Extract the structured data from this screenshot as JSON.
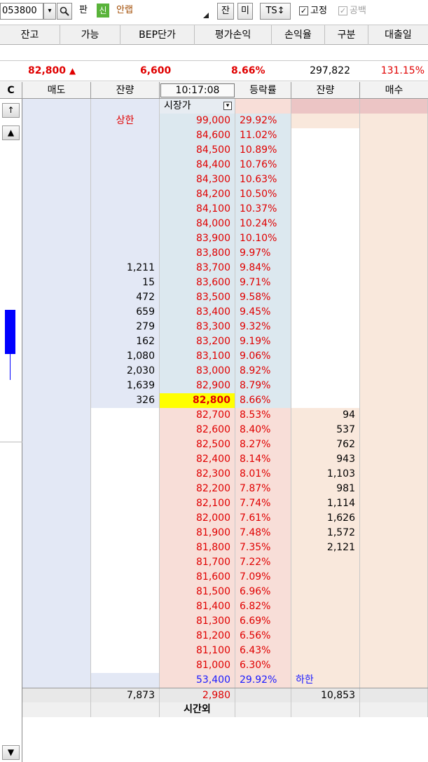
{
  "toolbar": {
    "code": "053800",
    "pan_label": "판",
    "sin_label": "신",
    "stock_name": "안랩",
    "jan_label": "잔",
    "mi_label": "미",
    "ts_label": "TS↕",
    "fix_label": "고정",
    "blank_label": "공백",
    "fix_checked": "✓",
    "blank_checked": "✓"
  },
  "columns": [
    "잔고",
    "가능",
    "BEP단가",
    "평가손익",
    "손익율",
    "구분",
    "대출일"
  ],
  "summary": {
    "price": "82,800",
    "arrow": "▲",
    "change": "6,600",
    "rate": "8.66%",
    "volume": "297,822",
    "ratio": "131.15%"
  },
  "orderbook": {
    "c_label": "C",
    "sell_label": "매도",
    "sell_qty_label": "잔량",
    "time": "10:17:08",
    "rate_label": "등락률",
    "buy_qty_label": "잔량",
    "buy_label": "매수",
    "market_price_label": "시장가",
    "dropdown_icon": "▾",
    "upper_limit_label": "상한",
    "lower_limit_label": "하한",
    "upper_limit_price": "99,000",
    "upper_limit_rate": "29.92%",
    "lower_limit_price": "53,400",
    "lower_limit_rate": "29.92%",
    "ask_rows": [
      {
        "qty": "",
        "price": "84,600",
        "rate": "11.02%"
      },
      {
        "qty": "",
        "price": "84,500",
        "rate": "10.89%"
      },
      {
        "qty": "",
        "price": "84,400",
        "rate": "10.76%"
      },
      {
        "qty": "",
        "price": "84,300",
        "rate": "10.63%"
      },
      {
        "qty": "",
        "price": "84,200",
        "rate": "10.50%"
      },
      {
        "qty": "",
        "price": "84,100",
        "rate": "10.37%"
      },
      {
        "qty": "",
        "price": "84,000",
        "rate": "10.24%"
      },
      {
        "qty": "",
        "price": "83,900",
        "rate": "10.10%"
      },
      {
        "qty": "",
        "price": "83,800",
        "rate": "9.97%"
      },
      {
        "qty": "1,211",
        "price": "83,700",
        "rate": "9.84%"
      },
      {
        "qty": "15",
        "price": "83,600",
        "rate": "9.71%"
      },
      {
        "qty": "472",
        "price": "83,500",
        "rate": "9.58%"
      },
      {
        "qty": "659",
        "price": "83,400",
        "rate": "9.45%"
      },
      {
        "qty": "279",
        "price": "83,300",
        "rate": "9.32%"
      },
      {
        "qty": "162",
        "price": "83,200",
        "rate": "9.19%"
      },
      {
        "qty": "1,080",
        "price": "83,100",
        "rate": "9.06%"
      },
      {
        "qty": "2,030",
        "price": "83,000",
        "rate": "8.92%"
      },
      {
        "qty": "1,639",
        "price": "82,900",
        "rate": "8.79%"
      },
      {
        "qty": "326",
        "price": "82,800",
        "rate": "8.66%",
        "current": true
      }
    ],
    "bid_rows": [
      {
        "qty": "94",
        "price": "82,700",
        "rate": "8.53%"
      },
      {
        "qty": "537",
        "price": "82,600",
        "rate": "8.40%"
      },
      {
        "qty": "762",
        "price": "82,500",
        "rate": "8.27%"
      },
      {
        "qty": "943",
        "price": "82,400",
        "rate": "8.14%"
      },
      {
        "qty": "1,103",
        "price": "82,300",
        "rate": "8.01%"
      },
      {
        "qty": "981",
        "price": "82,200",
        "rate": "7.87%"
      },
      {
        "qty": "1,114",
        "price": "82,100",
        "rate": "7.74%"
      },
      {
        "qty": "1,626",
        "price": "82,000",
        "rate": "7.61%"
      },
      {
        "qty": "1,572",
        "price": "81,900",
        "rate": "7.48%"
      },
      {
        "qty": "2,121",
        "price": "81,800",
        "rate": "7.35%"
      },
      {
        "qty": "",
        "price": "81,700",
        "rate": "7.22%"
      },
      {
        "qty": "",
        "price": "81,600",
        "rate": "7.09%"
      },
      {
        "qty": "",
        "price": "81,500",
        "rate": "6.96%"
      },
      {
        "qty": "",
        "price": "81,400",
        "rate": "6.82%"
      },
      {
        "qty": "",
        "price": "81,300",
        "rate": "6.69%"
      },
      {
        "qty": "",
        "price": "81,200",
        "rate": "6.56%"
      },
      {
        "qty": "",
        "price": "81,100",
        "rate": "6.43%"
      },
      {
        "qty": "",
        "price": "81,000",
        "rate": "6.30%"
      }
    ],
    "totals": {
      "sell_total": "7,873",
      "diff": "2,980",
      "buy_total": "10,853"
    },
    "after_hours_label": "시간외"
  },
  "side": {
    "c_icon": "C",
    "up_arrow": "↑",
    "scroll_up": "▲",
    "scroll_down": "▼"
  },
  "colors": {
    "ask_bg": "#e3e8f5",
    "bid_bg": "#f9e8dc",
    "price_ask_bg": "#dce8ef",
    "price_bid_bg": "#f8ded8",
    "current_bg": "#ffff00",
    "up": "#e00000",
    "down": "#1a1aff",
    "candle": "#0000ff"
  }
}
